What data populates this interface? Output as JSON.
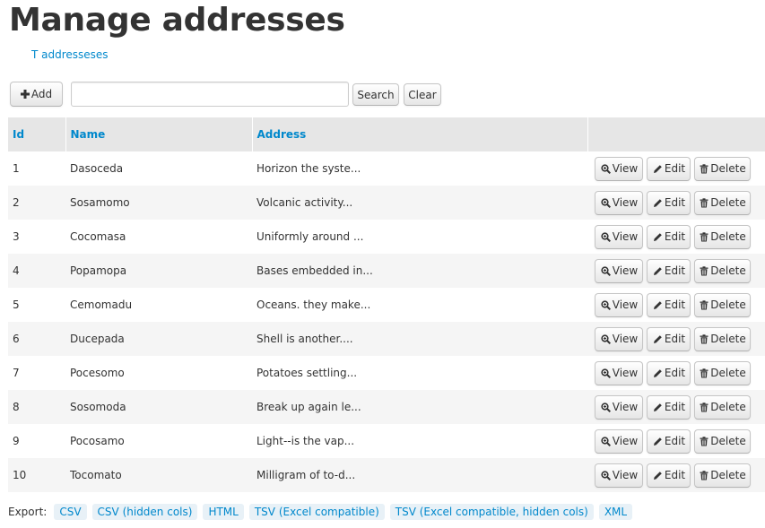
{
  "page": {
    "title": "Manage addresses",
    "breadcrumb": "T addresseses"
  },
  "toolbar": {
    "add_label": "Add",
    "search_value": "",
    "search_label": "Search",
    "clear_label": "Clear"
  },
  "table": {
    "columns": [
      "Id",
      "Name",
      "Address",
      ""
    ],
    "action_labels": {
      "view": "View",
      "edit": "Edit",
      "delete": "Delete"
    },
    "rows": [
      {
        "id": "1",
        "name": "Dasoceda",
        "address": "Horizon the syste..."
      },
      {
        "id": "2",
        "name": "Sosamomo",
        "address": "Volcanic activity..."
      },
      {
        "id": "3",
        "name": "Cocomasa",
        "address": "Uniformly around ..."
      },
      {
        "id": "4",
        "name": "Popamopa",
        "address": "Bases embedded in..."
      },
      {
        "id": "5",
        "name": "Cemomadu",
        "address": "Oceans. they make..."
      },
      {
        "id": "6",
        "name": "Ducepada",
        "address": "Shell is another...."
      },
      {
        "id": "7",
        "name": "Pocesomo",
        "address": "Potatoes settling..."
      },
      {
        "id": "8",
        "name": "Sosomoda",
        "address": "Break up again le..."
      },
      {
        "id": "9",
        "name": "Pocosamo",
        "address": "Light--is the vap..."
      },
      {
        "id": "10",
        "name": "Tocomato",
        "address": "Milligram of to-d..."
      }
    ]
  },
  "export": {
    "label": "Export:",
    "links": [
      "CSV",
      "CSV (hidden cols)",
      "HTML",
      "TSV (Excel compatible)",
      "TSV (Excel compatible, hidden cols)",
      "XML"
    ]
  },
  "icons": {
    "add": "plus-icon",
    "view": "zoom-in-icon",
    "edit": "pencil-icon",
    "delete": "trash-icon"
  },
  "colors": {
    "link": "#0088cc",
    "header_bg": "#e6e6e6",
    "row_alt_bg": "#f5f5f5"
  }
}
